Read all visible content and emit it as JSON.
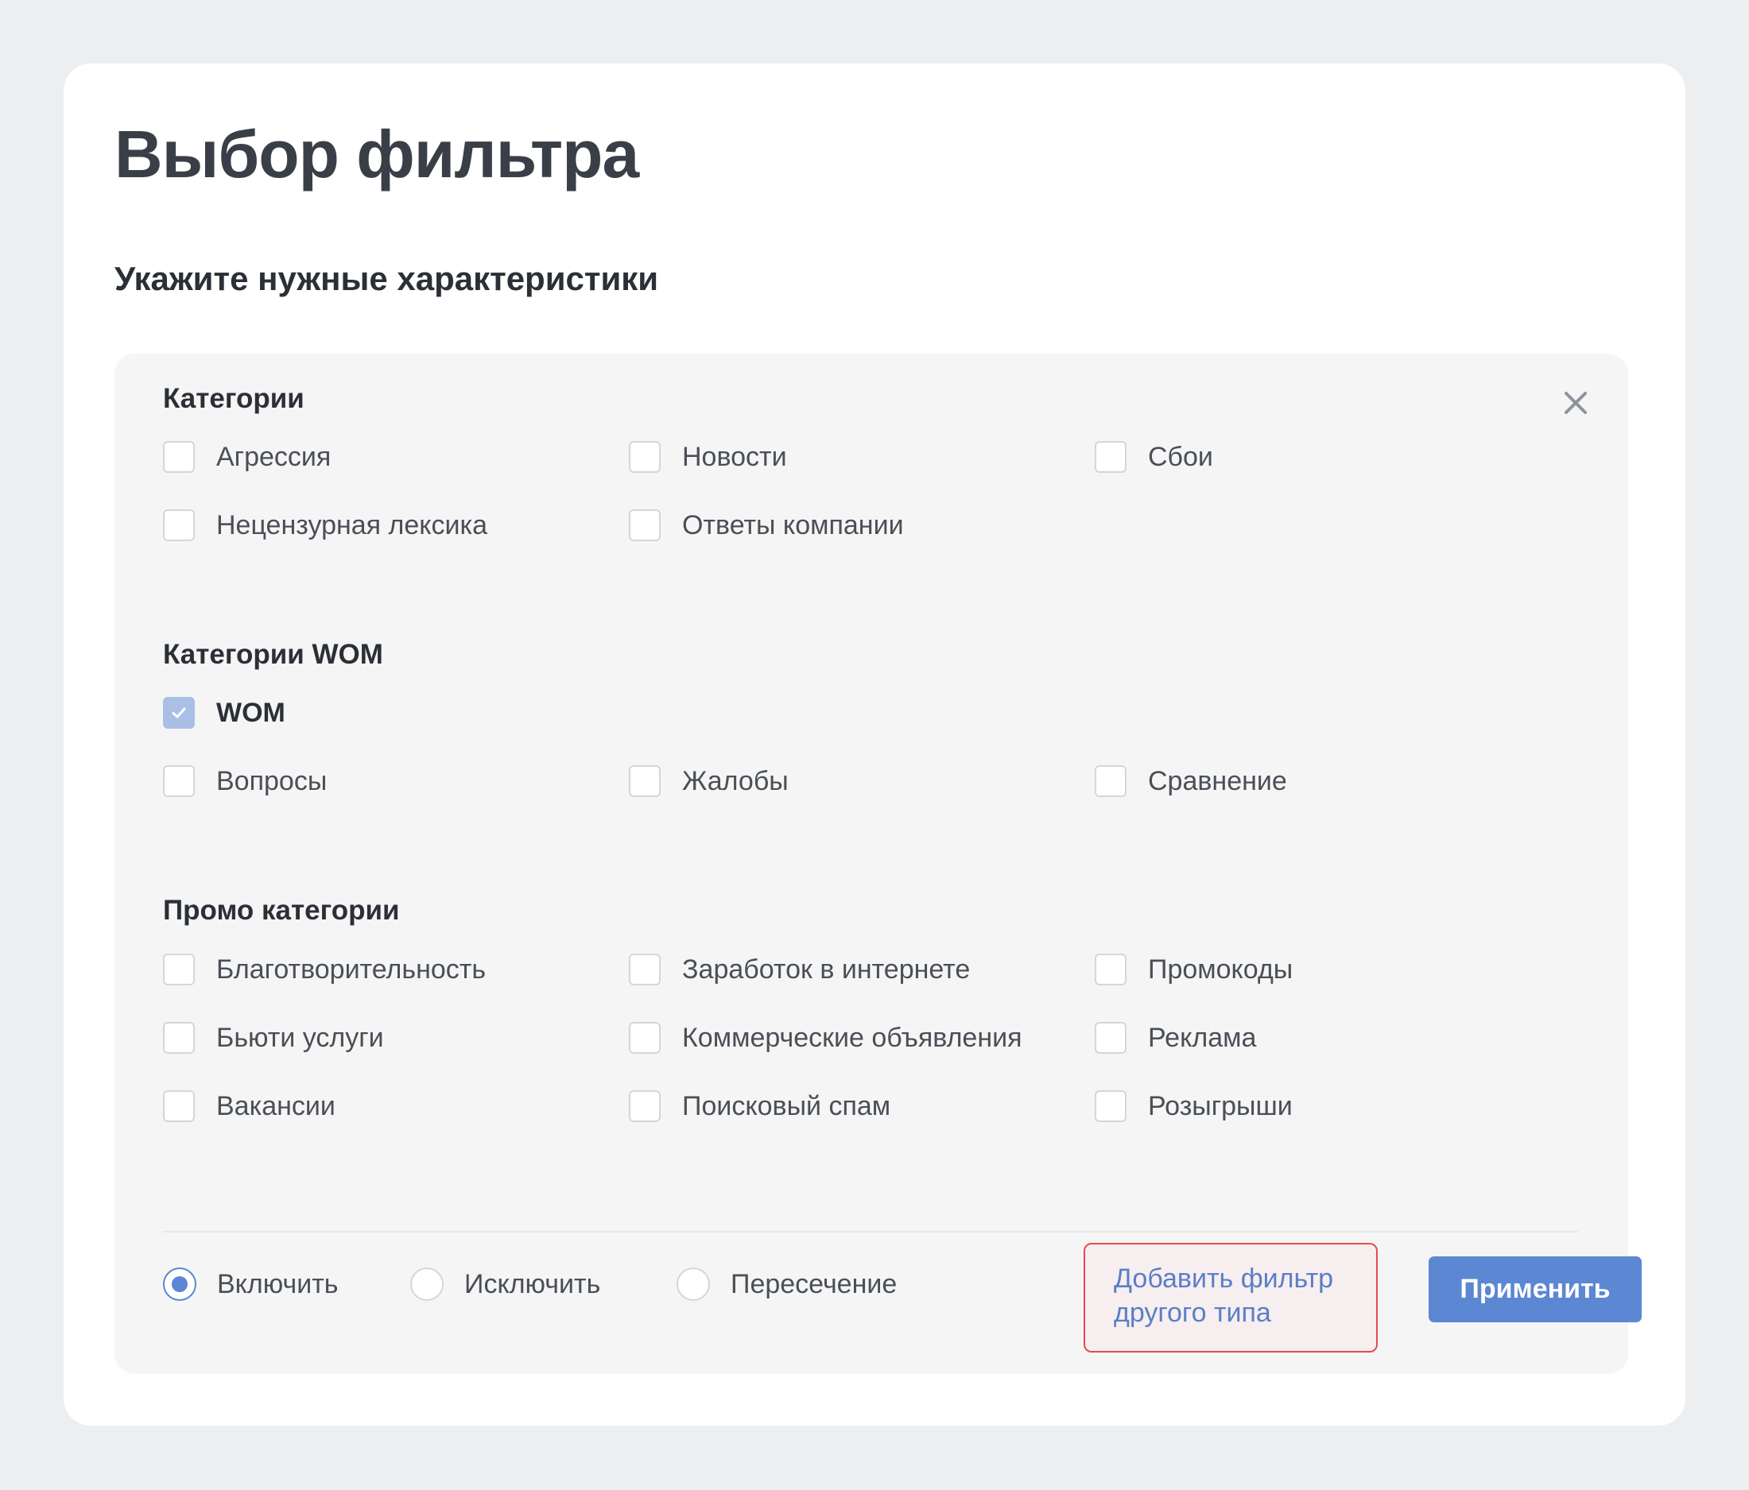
{
  "dialog": {
    "title": "Выбор фильтра",
    "subtitle": "Укажите нужные характеристики"
  },
  "categories": {
    "title": "Категории",
    "items": [
      {
        "label": "Агрессия",
        "checked": false
      },
      {
        "label": "Новости",
        "checked": false
      },
      {
        "label": "Сбои",
        "checked": false
      },
      {
        "label": "Нецензурная лексика",
        "checked": false
      },
      {
        "label": "Ответы компании",
        "checked": false
      }
    ]
  },
  "wom": {
    "title": "Категории WOM",
    "main": {
      "label": "WOM",
      "checked": true
    },
    "items": [
      {
        "label": "Вопросы",
        "checked": false
      },
      {
        "label": "Жалобы",
        "checked": false
      },
      {
        "label": "Сравнение",
        "checked": false
      }
    ]
  },
  "promo": {
    "title": "Промо категории",
    "items": [
      {
        "label": "Благотворительность",
        "checked": false
      },
      {
        "label": "Заработок в интернете",
        "checked": false
      },
      {
        "label": "Промокоды",
        "checked": false
      },
      {
        "label": "Бьюти услуги",
        "checked": false
      },
      {
        "label": "Коммерческие объявления",
        "checked": false
      },
      {
        "label": "Реклама",
        "checked": false
      },
      {
        "label": "Вакансии",
        "checked": false
      },
      {
        "label": "Поисковый спам",
        "checked": false
      },
      {
        "label": "Розыгрыши",
        "checked": false
      }
    ]
  },
  "mode": {
    "options": [
      {
        "label": "Включить",
        "selected": true
      },
      {
        "label": "Исключить",
        "selected": false
      },
      {
        "label": "Пересечение",
        "selected": false
      }
    ]
  },
  "actions": {
    "add_filter_line1": "Добавить фильтр",
    "add_filter_line2": "другого типа",
    "apply": "Применить"
  },
  "colors": {
    "accent": "#5c87d3",
    "checked_box": "#a9bfe6",
    "highlight_border": "#e24c4c",
    "background": "#edeef0",
    "panel": "#f5f5f5"
  },
  "icons": {
    "close": "close-icon",
    "check": "check-icon"
  }
}
